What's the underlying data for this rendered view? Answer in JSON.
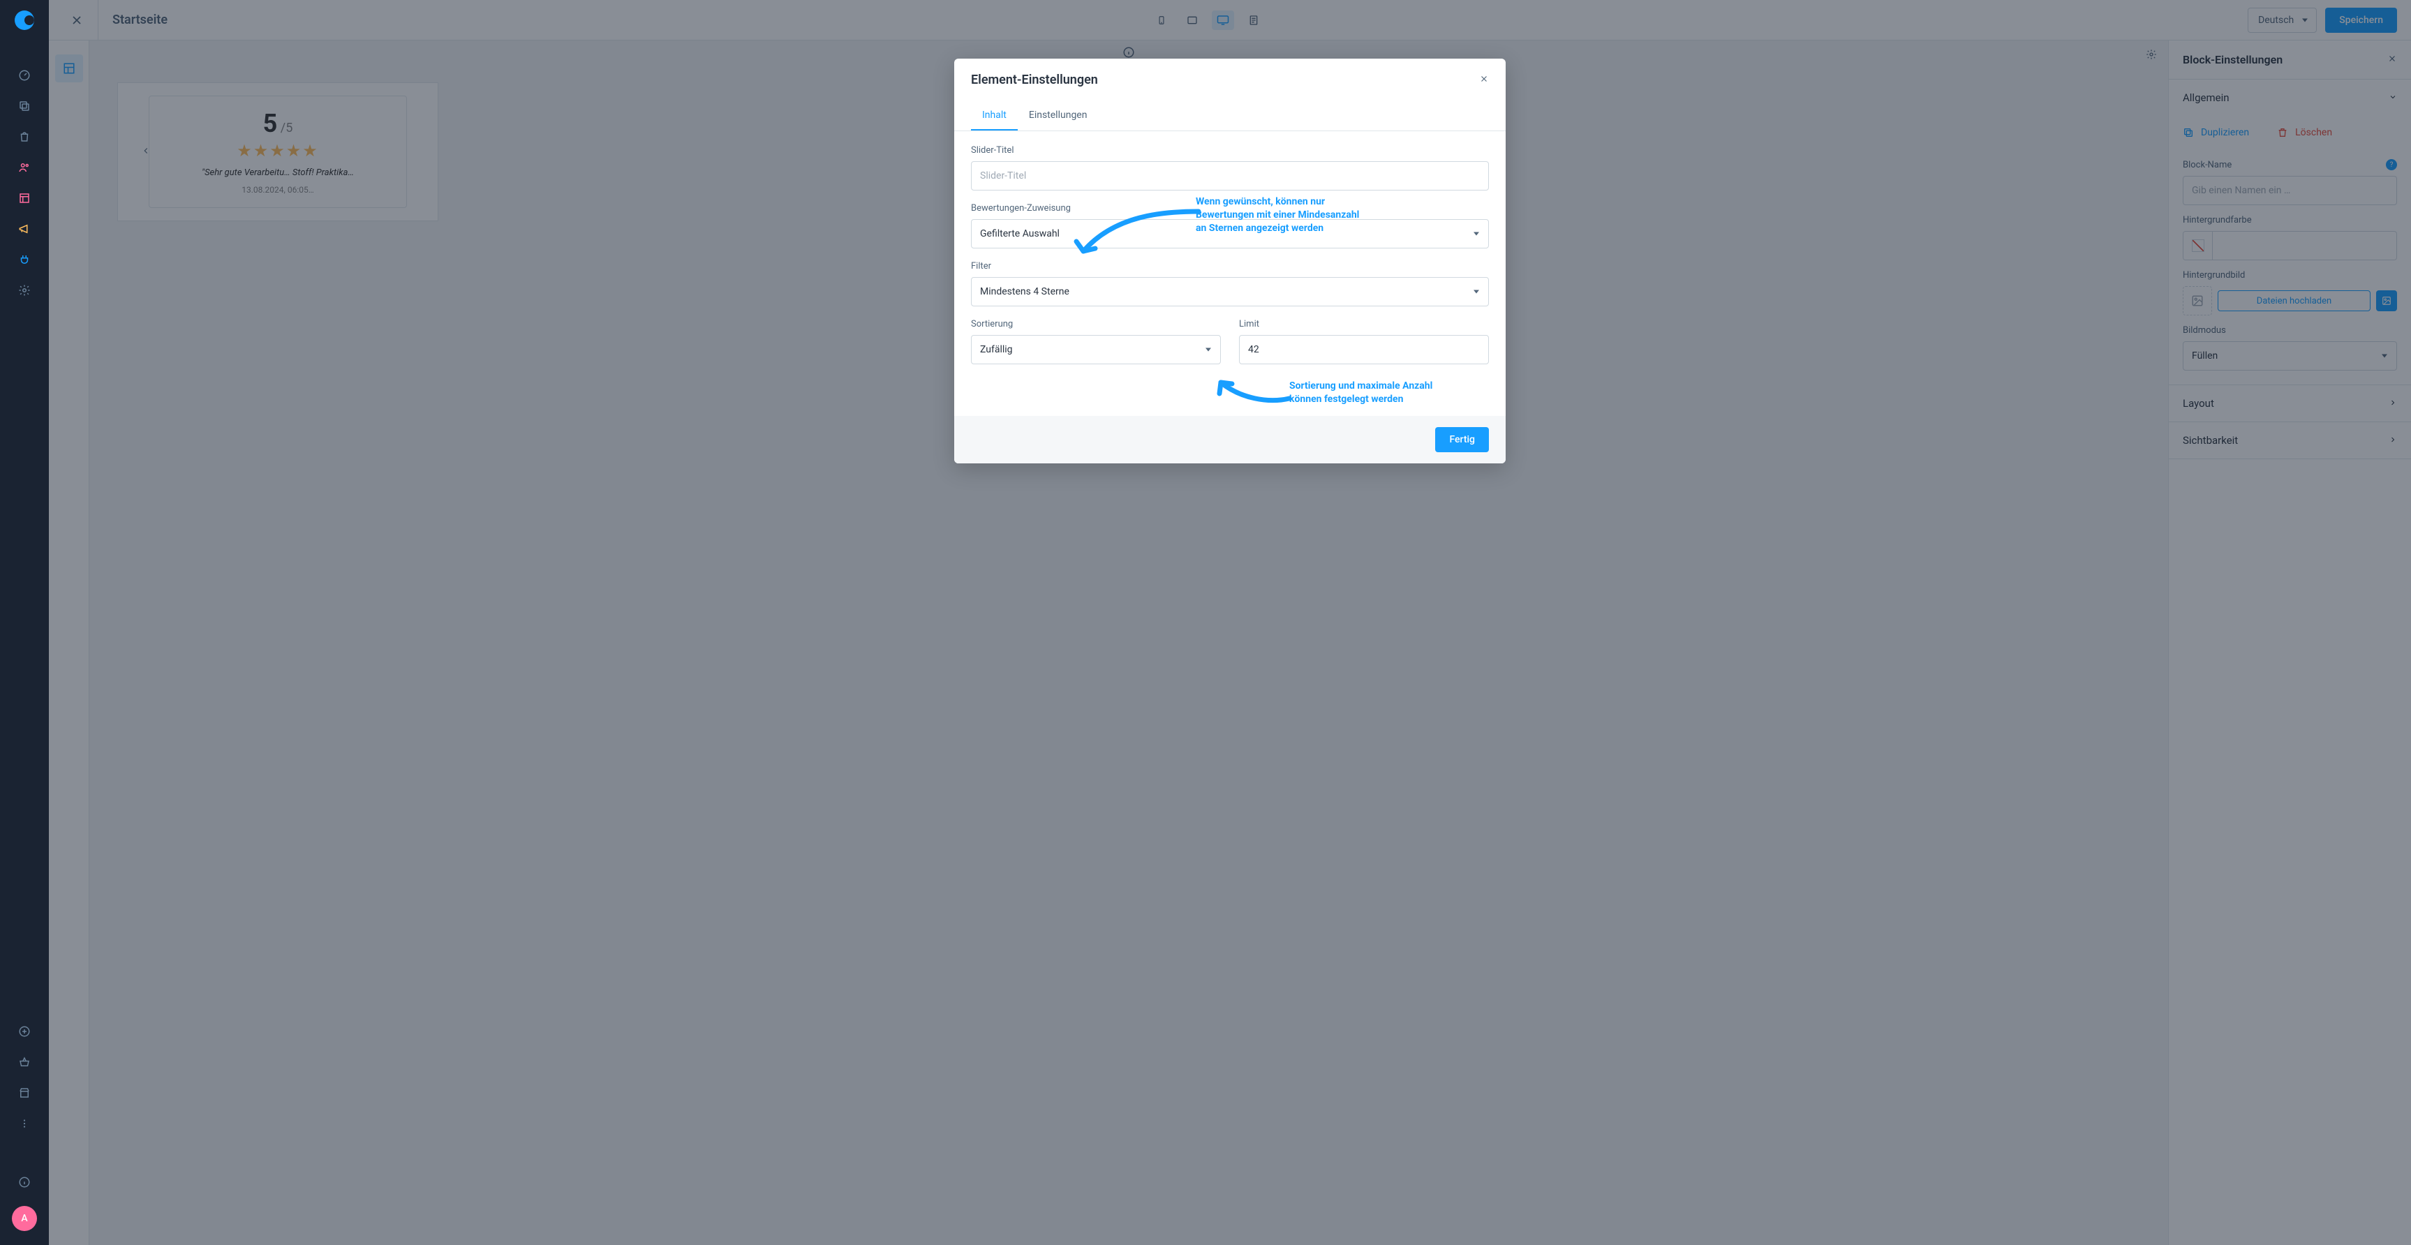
{
  "topbar": {
    "title": "Startseite",
    "language": "Deutsch",
    "save": "Speichern"
  },
  "avatar_initial": "A",
  "canvas": {
    "rating_value": "5",
    "rating_sep": " /",
    "rating_outof": "5",
    "stars": "★★★★★",
    "review_text": "\"Sehr gute Verarbeitu… Stoff! Praktika…",
    "review_date": "13.08.2024, 06:05…"
  },
  "right_panel": {
    "title": "Block-Einstellungen",
    "sections": {
      "general": "Allgemein",
      "layout": "Layout",
      "visibility": "Sichtbarkeit"
    },
    "actions": {
      "duplicate": "Duplizieren",
      "delete": "Löschen"
    },
    "fields": {
      "block_name_label": "Block-Name",
      "block_name_placeholder": "Gib einen Namen ein …",
      "bg_color_label": "Hintergrundfarbe",
      "bg_image_label": "Hintergrundbild",
      "upload": "Dateien hochladen",
      "image_mode_label": "Bildmodus",
      "image_mode_value": "Füllen"
    }
  },
  "modal": {
    "title": "Element-Einstellungen",
    "tabs": {
      "content": "Inhalt",
      "settings": "Einstellungen"
    },
    "fields": {
      "slider_title_label": "Slider-Titel",
      "slider_title_placeholder": "Slider-Titel",
      "assignment_label": "Bewertungen-Zuweisung",
      "assignment_value": "Gefilterte Auswahl",
      "filter_label": "Filter",
      "filter_value": "Mindestens 4 Sterne",
      "sort_label": "Sortierung",
      "sort_value": "Zufällig",
      "limit_label": "Limit",
      "limit_value": "42"
    },
    "callout1_l1": "Wenn gewünscht, können nur",
    "callout1_l2": "Bewertungen mit einer Mindesanzahl",
    "callout1_l3": "an Sternen angezeigt werden",
    "callout2_l1": "Sortierung und maximale Anzahl",
    "callout2_l2": "können festgelegt werden",
    "done": "Fertig"
  }
}
